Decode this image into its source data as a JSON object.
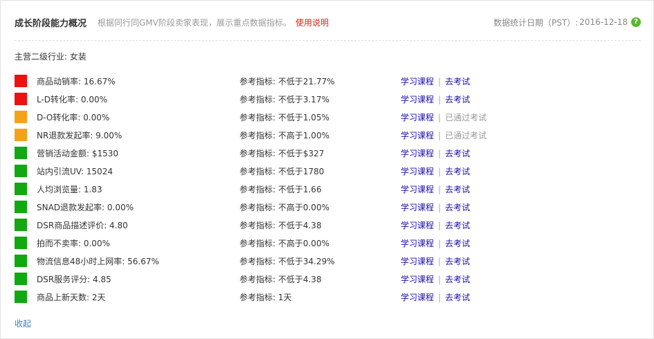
{
  "header": {
    "title": "成长阶段能力概况",
    "subtitle": "根据同行同GMV阶段卖家表现，展示重点数据指标。",
    "help_link": "使用说明",
    "date_label": "数据统计日期（PST）:",
    "date_value": "2016-12-18",
    "help_icon": "?"
  },
  "industry": "主营二级行业: 女装",
  "colors": {
    "red": "#ee1111",
    "orange": "#f5a21b",
    "green": "#11a811"
  },
  "rows": [
    {
      "status": "red",
      "metric": "商品动销率: 16.67%",
      "reference": "参考指标: 不低于21.77%",
      "course": "学习课程",
      "sep": "|",
      "exam": "去考试",
      "passed": false
    },
    {
      "status": "red",
      "metric": "L-D转化率: 0.00%",
      "reference": "参考指标: 不低于3.17%",
      "course": "学习课程",
      "sep": "|",
      "exam": "去考试",
      "passed": false
    },
    {
      "status": "orange",
      "metric": "D-O转化率: 0.00%",
      "reference": "参考指标: 不低于1.05%",
      "course": "学习课程",
      "sep": "|",
      "exam": "已通过考试",
      "passed": true
    },
    {
      "status": "orange",
      "metric": "NR退款发起率: 9.00%",
      "reference": "参考指标: 不高于1.00%",
      "course": "学习课程",
      "sep": "|",
      "exam": "已通过考试",
      "passed": true
    },
    {
      "status": "green",
      "metric": "营销活动金额: $1530",
      "reference": "参考指标: 不低于$327",
      "course": "学习课程",
      "sep": "|",
      "exam": "去考试",
      "passed": false
    },
    {
      "status": "green",
      "metric": "站内引流UV: 15024",
      "reference": "参考指标: 不低于1780",
      "course": "学习课程",
      "sep": "|",
      "exam": "去考试",
      "passed": false
    },
    {
      "status": "green",
      "metric": "人均浏览量: 1.83",
      "reference": "参考指标: 不低于1.66",
      "course": "学习课程",
      "sep": "|",
      "exam": "去考试",
      "passed": false
    },
    {
      "status": "green",
      "metric": "SNAD退款发起率: 0.00%",
      "reference": "参考指标: 不高于0.00%",
      "course": "学习课程",
      "sep": "|",
      "exam": "去考试",
      "passed": false
    },
    {
      "status": "green",
      "metric": "DSR商品描述评价: 4.80",
      "reference": "参考指标: 不低于4.38",
      "course": "学习课程",
      "sep": "|",
      "exam": "去考试",
      "passed": false
    },
    {
      "status": "green",
      "metric": "拍而不卖率: 0.00%",
      "reference": "参考指标: 不高于0.00%",
      "course": "学习课程",
      "sep": "|",
      "exam": "去考试",
      "passed": false
    },
    {
      "status": "green",
      "metric": "物流信息48小时上网率: 56.67%",
      "reference": "参考指标: 不低于34.29%",
      "course": "学习课程",
      "sep": "|",
      "exam": "去考试",
      "passed": false
    },
    {
      "status": "green",
      "metric": "DSR服务评分: 4.85",
      "reference": "参考指标: 不低于4.38",
      "course": "学习课程",
      "sep": "|",
      "exam": "去考试",
      "passed": false
    },
    {
      "status": "green",
      "metric": "商品上新天数: 2天",
      "reference": "参考指标: 1天",
      "course": "学习课程",
      "sep": "|",
      "exam": "去考试",
      "passed": false
    }
  ],
  "footer": {
    "collapse_label": "收起"
  }
}
